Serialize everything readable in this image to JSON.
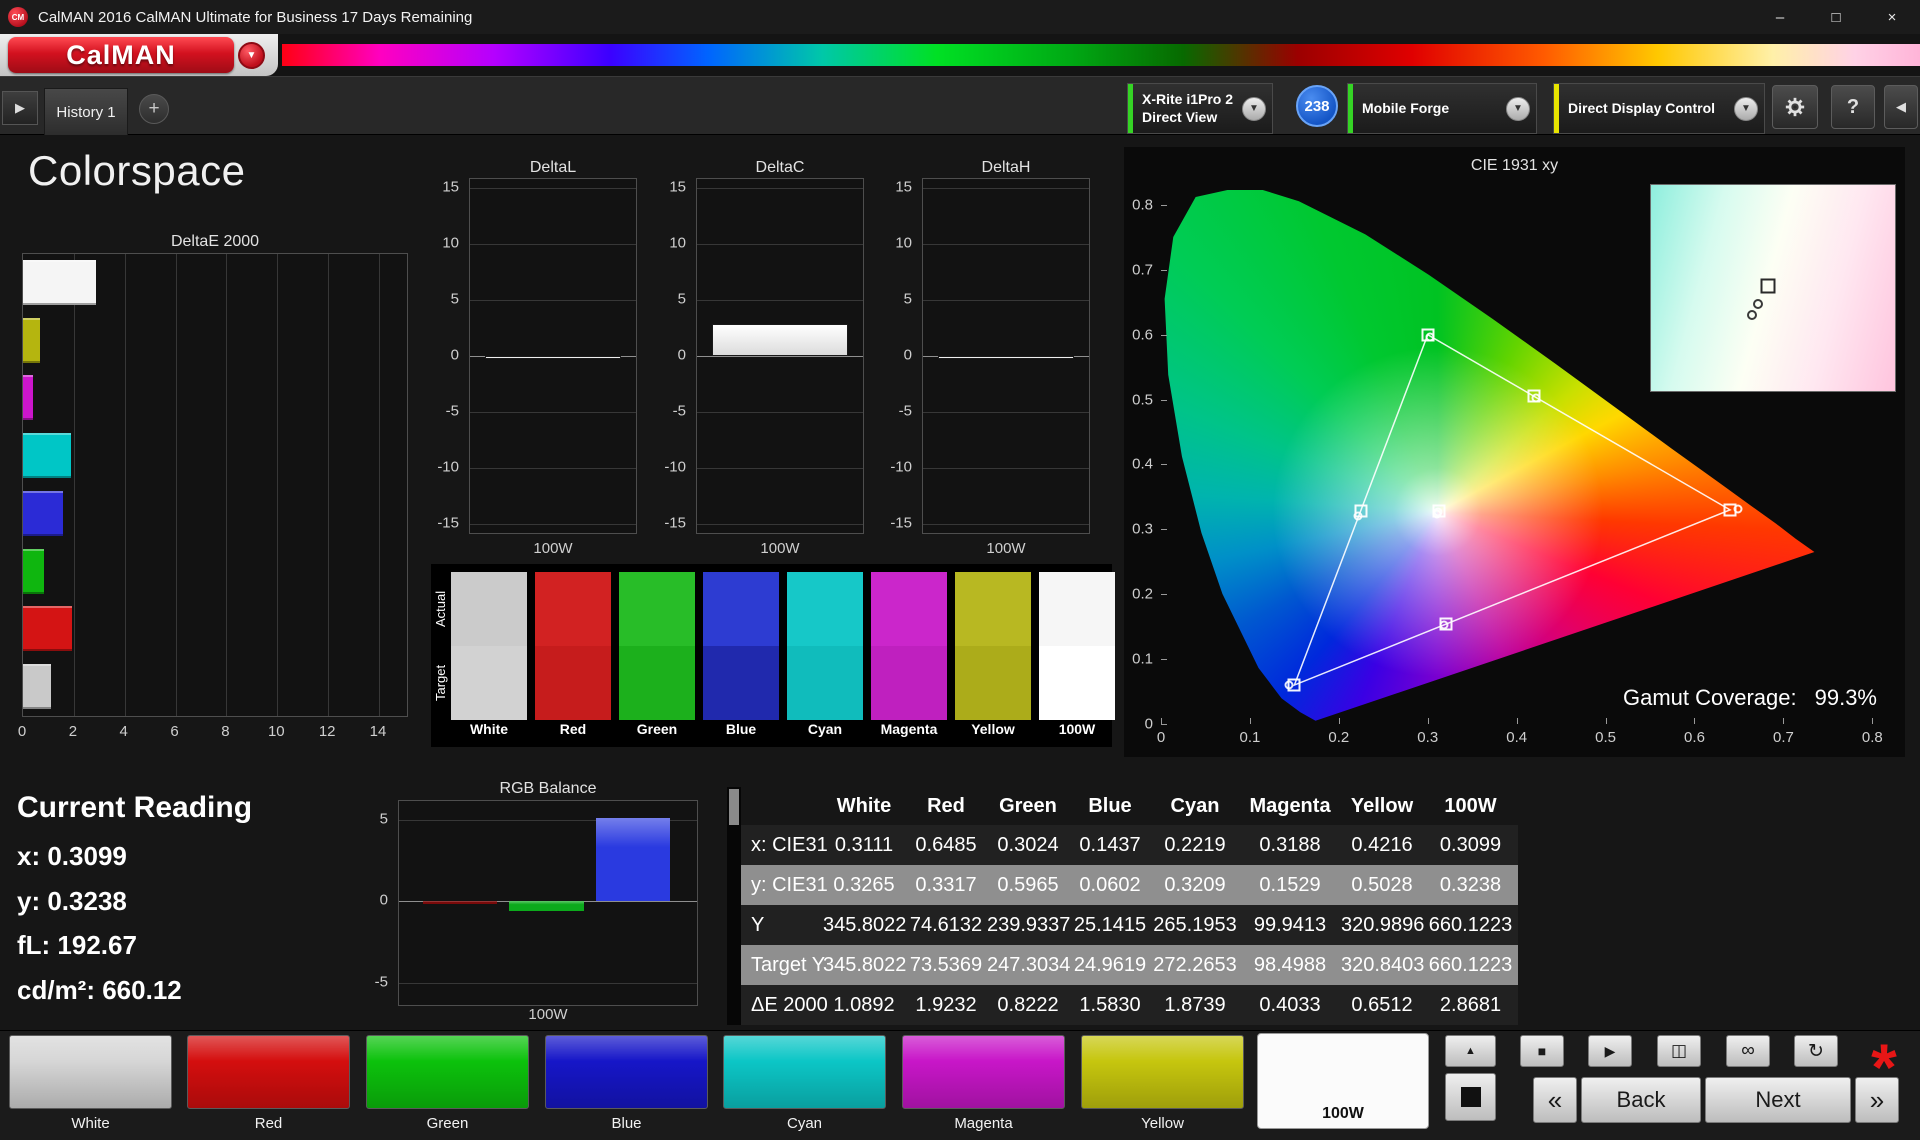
{
  "window": {
    "title": "CalMAN 2016 CalMAN Ultimate for Business 17 Days Remaining",
    "app_icon_text": "CM",
    "minimize_glyph": "–",
    "maximize_glyph": "□",
    "close_glyph": "×"
  },
  "brand": {
    "logo_text": "CalMAN",
    "accent_color": "#d3111f"
  },
  "toolbar": {
    "expand_left_glyph": "▶",
    "history_tab": "History 1",
    "add_tab_glyph": "+",
    "caret_glyph": "▼",
    "meter": {
      "line1": "X-Rite i1Pro 2",
      "line2": "Direct View",
      "accent_color": "#35d425"
    },
    "reading_count_badge": "238",
    "source": {
      "label": "Mobile Forge",
      "accent_color": "#35d425"
    },
    "display_control": {
      "label": "Direct Display Control",
      "accent_color": "#e8e400"
    },
    "help_glyph": "?",
    "collapse_right_glyph": "◀"
  },
  "page": {
    "title": "Colorspace"
  },
  "current_reading": {
    "title": "Current Reading",
    "lines": [
      "x: 0.3099",
      "y: 0.3238",
      "fL: 192.67",
      "cd/m²: 660.12"
    ]
  },
  "gamut": {
    "label": "Gamut Coverage:",
    "value": "99.3%"
  },
  "swatches": {
    "axis_labels": [
      "Actual",
      "Target"
    ],
    "items": [
      {
        "label": "White",
        "actual": "#cbcbcb",
        "target": "#d2d2d2"
      },
      {
        "label": "Red",
        "actual": "#d22222",
        "target": "#c61c1c"
      },
      {
        "label": "Green",
        "actual": "#28bd28",
        "target": "#1cb01c"
      },
      {
        "label": "Blue",
        "actual": "#2d3cd2",
        "target": "#2029ad"
      },
      {
        "label": "Cyan",
        "actual": "#16c8c8",
        "target": "#10bcbc"
      },
      {
        "label": "Magenta",
        "actual": "#cb26cb",
        "target": "#bf20bf"
      },
      {
        "label": "Yellow",
        "actual": "#b8b822",
        "target": "#acac1a"
      },
      {
        "label": "100W",
        "actual": "#f6f6f6",
        "target": "#ffffff"
      }
    ]
  },
  "pattern_buttons": [
    {
      "label": "White",
      "color": "#d6d6d6",
      "selected": false
    },
    {
      "label": "Red",
      "color": "#d40e0e",
      "selected": false
    },
    {
      "label": "Green",
      "color": "#0cc20c",
      "selected": false
    },
    {
      "label": "Blue",
      "color": "#1616c8",
      "selected": false
    },
    {
      "label": "Cyan",
      "color": "#0cc6c6",
      "selected": false
    },
    {
      "label": "Magenta",
      "color": "#c816c8",
      "selected": false
    },
    {
      "label": "Yellow",
      "color": "#c6c60e",
      "selected": false
    },
    {
      "label": "100W",
      "color": "#ffffff",
      "selected": true
    }
  ],
  "transport": {
    "collapse_up_glyph": "▲",
    "stop_glyph": "■",
    "play_glyph": "▶",
    "frame_glyph": "◫",
    "loop_glyph": "∞",
    "refresh_glyph": "↻",
    "alert_glyph": "*",
    "prev_glyph": "«",
    "back_label": "Back",
    "next_label": "Next",
    "fwd_glyph": "»"
  },
  "chart_data": [
    {
      "id": "delta_e_2000",
      "type": "bar",
      "orientation": "horizontal",
      "title": "DeltaE 2000",
      "categories": [
        "100W",
        "Yellow",
        "Magenta",
        "Cyan",
        "Blue",
        "Green",
        "Red",
        "White"
      ],
      "values": [
        2.8681,
        0.6512,
        0.4033,
        1.8739,
        1.583,
        0.8222,
        1.9232,
        1.0892
      ],
      "colors": [
        "#f5f5f5",
        "#b5b50f",
        "#cc16cc",
        "#00c6c6",
        "#2b2bd6",
        "#0fb60f",
        "#d41414",
        "#c9c9c9"
      ],
      "xlim": [
        0,
        15.1
      ],
      "xticks": [
        0,
        2,
        4,
        6,
        8,
        10,
        12,
        14
      ],
      "grid": true
    },
    {
      "id": "delta_l",
      "type": "bar",
      "title": "DeltaL",
      "categories": [
        "100W"
      ],
      "values": [
        0.0
      ],
      "ylim": [
        -15.8,
        15.8
      ],
      "yticks": [
        15,
        10,
        5,
        0,
        -5,
        -10,
        -15
      ],
      "x_axis_label": "100W"
    },
    {
      "id": "delta_c",
      "type": "bar",
      "title": "DeltaC",
      "categories": [
        "100W"
      ],
      "values": [
        2.86
      ],
      "ylim": [
        -15.8,
        15.8
      ],
      "yticks": [
        15,
        10,
        5,
        0,
        -5,
        -10,
        -15
      ],
      "x_axis_label": "100W"
    },
    {
      "id": "delta_h",
      "type": "bar",
      "title": "DeltaH",
      "categories": [
        "100W"
      ],
      "values": [
        0.0
      ],
      "ylim": [
        -15.8,
        15.8
      ],
      "yticks": [
        15,
        10,
        5,
        0,
        -5,
        -10,
        -15
      ],
      "x_axis_label": "100W"
    },
    {
      "id": "rgb_balance",
      "type": "bar",
      "title": "RGB Balance",
      "x_axis_label": "100W",
      "series": [
        {
          "name": "Red",
          "value": 0.0,
          "color": "#7a0a0a"
        },
        {
          "name": "Green",
          "value": -0.6,
          "color": "#0caa1c"
        },
        {
          "name": "Blue",
          "value": 5.1,
          "color": "#2a3ae0"
        }
      ],
      "ylim": [
        -6.35,
        6.15
      ],
      "yticks": [
        5,
        0,
        -5
      ]
    },
    {
      "id": "cie_1931",
      "type": "scatter",
      "title": "CIE 1931 xy",
      "xlim": [
        0,
        0.8
      ],
      "ylim": [
        0,
        0.8
      ],
      "plot_xmax": 0.812,
      "plot_ymax": 0.823,
      "xticks": [
        0,
        0.1,
        0.2,
        0.3,
        0.4,
        0.5,
        0.6,
        0.7,
        0.8
      ],
      "yticks": [
        0,
        0.1,
        0.2,
        0.3,
        0.4,
        0.5,
        0.6,
        0.7,
        0.8
      ],
      "gamut_triangle": [
        {
          "x": 0.64,
          "y": 0.33
        },
        {
          "x": 0.3,
          "y": 0.6
        },
        {
          "x": 0.15,
          "y": 0.06
        }
      ],
      "targets": [
        {
          "name": "White",
          "x": 0.3127,
          "y": 0.329
        },
        {
          "name": "Red",
          "x": 0.64,
          "y": 0.33
        },
        {
          "name": "Green",
          "x": 0.3,
          "y": 0.6
        },
        {
          "name": "Blue",
          "x": 0.15,
          "y": 0.06
        },
        {
          "name": "Cyan",
          "x": 0.2246,
          "y": 0.3287
        },
        {
          "name": "Magenta",
          "x": 0.3209,
          "y": 0.1542
        },
        {
          "name": "Yellow",
          "x": 0.4193,
          "y": 0.5053
        }
      ],
      "measurements": [
        {
          "name": "White",
          "x": 0.3111,
          "y": 0.3265
        },
        {
          "name": "Red",
          "x": 0.6485,
          "y": 0.3317
        },
        {
          "name": "Green",
          "x": 0.3024,
          "y": 0.5965
        },
        {
          "name": "Blue",
          "x": 0.1437,
          "y": 0.0602
        },
        {
          "name": "Cyan",
          "x": 0.2219,
          "y": 0.3209
        },
        {
          "name": "Magenta",
          "x": 0.3188,
          "y": 0.1529
        },
        {
          "name": "Yellow",
          "x": 0.4216,
          "y": 0.5028
        },
        {
          "name": "100W",
          "x": 0.3099,
          "y": 0.3238
        }
      ],
      "gamut_coverage": "99.3%"
    },
    {
      "id": "results_table",
      "type": "table",
      "columns": [
        "",
        "White",
        "Red",
        "Green",
        "Blue",
        "Cyan",
        "Magenta",
        "Yellow",
        "100W"
      ],
      "rows": [
        {
          "label": "x: CIE31",
          "values": [
            "0.3111",
            "0.6485",
            "0.3024",
            "0.1437",
            "0.2219",
            "0.3188",
            "0.4216",
            "0.3099"
          ]
        },
        {
          "label": "y: CIE31",
          "values": [
            "0.3265",
            "0.3317",
            "0.5965",
            "0.0602",
            "0.3209",
            "0.1529",
            "0.5028",
            "0.3238"
          ]
        },
        {
          "label": "Y",
          "values": [
            "345.8022",
            "74.6132",
            "239.9337",
            "25.1415",
            "265.1953",
            "99.9413",
            "320.9896",
            "660.1223"
          ]
        },
        {
          "label": "Target Y",
          "values": [
            "345.8022",
            "73.5369",
            "247.3034",
            "24.9619",
            "272.2653",
            "98.4988",
            "320.8403",
            "660.1223"
          ]
        },
        {
          "label": "ΔE 2000",
          "values": [
            "1.0892",
            "1.9232",
            "0.8222",
            "1.5830",
            "1.8739",
            "0.4033",
            "0.6512",
            "2.8681"
          ]
        }
      ]
    }
  ]
}
